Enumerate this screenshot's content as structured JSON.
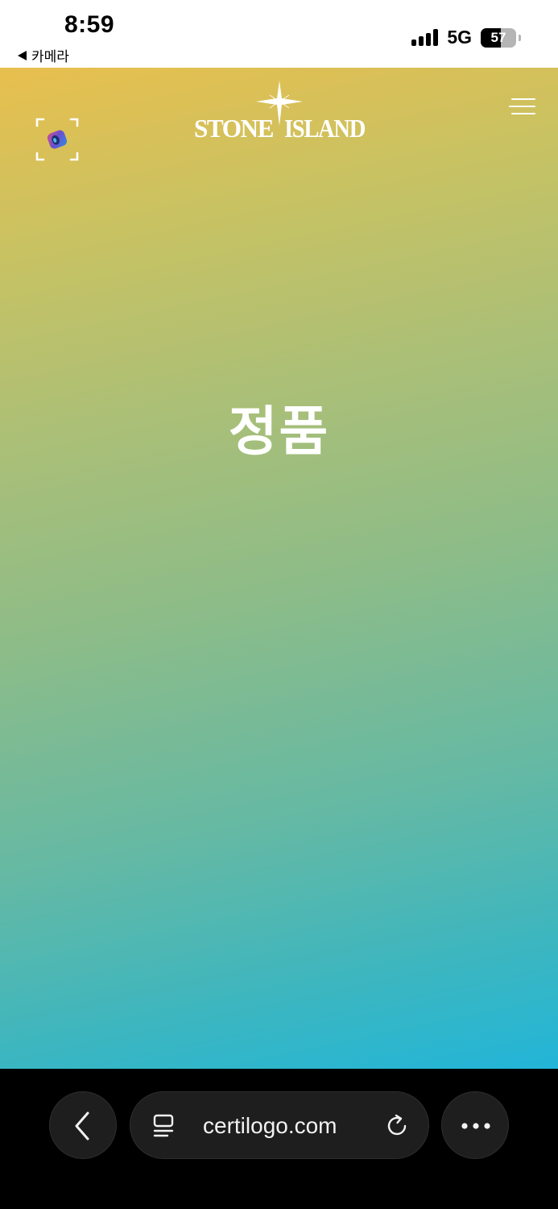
{
  "status_bar": {
    "time": "8:59",
    "back_app": "카메라",
    "network": "5G",
    "battery": "57",
    "battery_level": 0.57,
    "signal_bars": 4
  },
  "page": {
    "brand": {
      "left": "STONE",
      "right": "ISLAND"
    },
    "verdict": "정품",
    "icons": {
      "scan": "scan-frame-icon",
      "menu": "hamburger-menu-icon",
      "logo": "compass-rose-icon"
    },
    "colors": {
      "gradient_top": "#e8bf4e",
      "gradient_bottom": "#22b5d8",
      "text": "#ffffff"
    }
  },
  "browser": {
    "url": "certilogo.com",
    "icons": {
      "back": "chevron-left-icon",
      "tabs": "tabs-icon",
      "reload": "reload-icon",
      "more": "more-dots-icon"
    }
  }
}
